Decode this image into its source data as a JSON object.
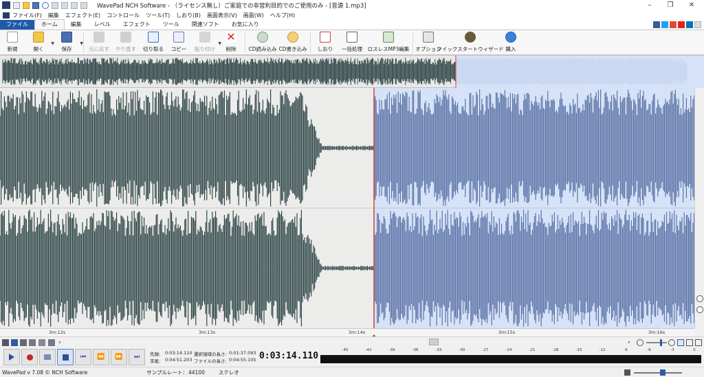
{
  "window": {
    "title": "WavePad NCH Software - （ライセンス無し）ご家庭での非営利目的でのご使用のみ - [音源 1.mp3]",
    "minimize_glyph": "–",
    "maximize_glyph": "❐",
    "close_glyph": "✕"
  },
  "menubar": {
    "items": [
      "ファイル(F)",
      "編集",
      "エフェクト(E)",
      "コントロール",
      "ツール(T)",
      "しおり(B)",
      "画面表示(V)",
      "画面(W)",
      "ヘルプ(H)"
    ]
  },
  "ribbon_tabs": {
    "items": [
      "ファイル",
      "ホーム",
      "編集",
      "レベル",
      "エフェクト",
      "ツール",
      "関連ソフト",
      "お気に入り"
    ],
    "active": "ホーム"
  },
  "social": {
    "icons": [
      "facebook-icon",
      "twitter-icon",
      "googleplus-icon",
      "youtube-icon",
      "linkedin-icon",
      "dropdown-icon"
    ]
  },
  "toolbar": {
    "new": "新規",
    "open": "開く",
    "save": "保存",
    "undo": "元に戻す",
    "redo": "やり直す",
    "cut": "切り取る",
    "copy": "コピー",
    "paste": "貼り付け",
    "delete": "削除",
    "cd_rip": "CD読み込み",
    "cd_burn": "CD書き込み",
    "bookmark": "しおり",
    "batch": "一括処理",
    "lossless": "ロスレスMP3編集",
    "options": "オプション",
    "wizard": "クイックスタートウィザード",
    "buy": "購入"
  },
  "timeline": {
    "labels": [
      "3m:12s",
      "3m:13s",
      "3m:14s",
      "3m:15s",
      "3m:16s"
    ]
  },
  "transport": {
    "start_label": "先頭:",
    "start_value": "0:03:14.110",
    "end_label": "末尾:",
    "end_value": "0:04:51.203",
    "sel_len_label": "選択領域の長さ:",
    "sel_len_value": "0:01:37.093",
    "file_len_label": "ファイルの長さ:",
    "file_len_value": "0:04:55.105",
    "current_time": "0:03:14.110"
  },
  "meter": {
    "scale": [
      "-45",
      "-42",
      "-39",
      "-36",
      "-33",
      "-30",
      "-27",
      "-24",
      "-21",
      "-18",
      "-15",
      "-12",
      "-9",
      "-6",
      "-3",
      "0"
    ]
  },
  "statusbar": {
    "version": "WavePad v 7.08 © NCH Software",
    "sample_rate_label": "サンプルレート：",
    "sample_rate_value": "44100",
    "channel": "ステレオ"
  },
  "colors": {
    "wave_dark": "#2f4547",
    "wave_selected": "#5b73a6",
    "selection_bg": "#d6e2f7",
    "playhead": "#e0342c"
  }
}
